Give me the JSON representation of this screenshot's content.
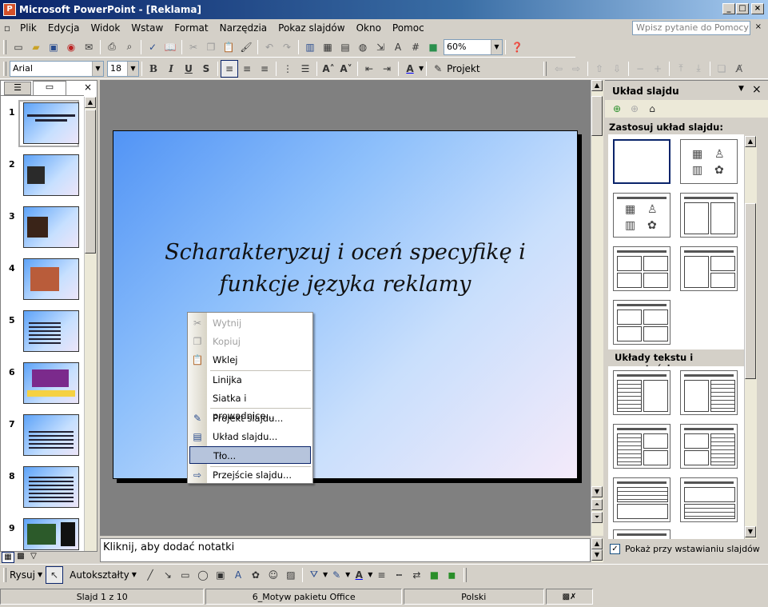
{
  "window": {
    "title": "Microsoft PowerPoint - [Reklama]"
  },
  "menu": {
    "items": [
      "Plik",
      "Edycja",
      "Widok",
      "Wstaw",
      "Format",
      "Narzędzia",
      "Pokaz slajdów",
      "Okno",
      "Pomoc"
    ],
    "help_placeholder": "Wpisz pytanie do Pomocy"
  },
  "toolbar": {
    "zoom": "60%",
    "font": "Arial",
    "font_size": "18",
    "design_label": "Projekt"
  },
  "slides": {
    "numbers": [
      "1",
      "2",
      "3",
      "4",
      "5",
      "6",
      "7",
      "8",
      "9"
    ],
    "current": "1"
  },
  "slide": {
    "title": "Scharakteryzuj i oceń specyfikę i funkcje języka reklamy"
  },
  "notes": {
    "placeholder": "Kliknij, aby dodać notatki"
  },
  "context_menu": {
    "items": [
      {
        "label": "Wytnij",
        "icon": "scissors-icon",
        "disabled": true
      },
      {
        "label": "Kopiuj",
        "icon": "copy-icon",
        "disabled": true
      },
      {
        "label": "Wklej",
        "icon": "paste-icon",
        "disabled": false
      },
      {
        "label": "Linijka",
        "icon": "",
        "disabled": false
      },
      {
        "label": "Siatka i prowadnice...",
        "icon": "",
        "disabled": false
      },
      {
        "label": "Projekt slajdu...",
        "icon": "design-icon",
        "disabled": false
      },
      {
        "label": "Układ slajdu...",
        "icon": "layout-icon",
        "disabled": false
      },
      {
        "label": "Tło...",
        "icon": "",
        "disabled": false,
        "highlighted": true
      },
      {
        "label": "Przejście slajdu...",
        "icon": "transition-icon",
        "disabled": false
      }
    ]
  },
  "task_pane": {
    "title": "Układ slajdu",
    "apply_label": "Zastosuj układ slajdu:",
    "section2": "Układy tekstu i zawartości",
    "checkbox_label": "Pokaż przy wstawianiu slajdów",
    "checkbox_checked": true
  },
  "drawing": {
    "draw_label": "Rysuj",
    "autoshapes_label": "Autokształty"
  },
  "status": {
    "slide": "Slajd 1 z 10",
    "design": "6_Motyw pakietu Office",
    "language": "Polski"
  },
  "colors": {
    "title_bar_start": "#0a246a",
    "highlight": "#b6c4dc"
  }
}
